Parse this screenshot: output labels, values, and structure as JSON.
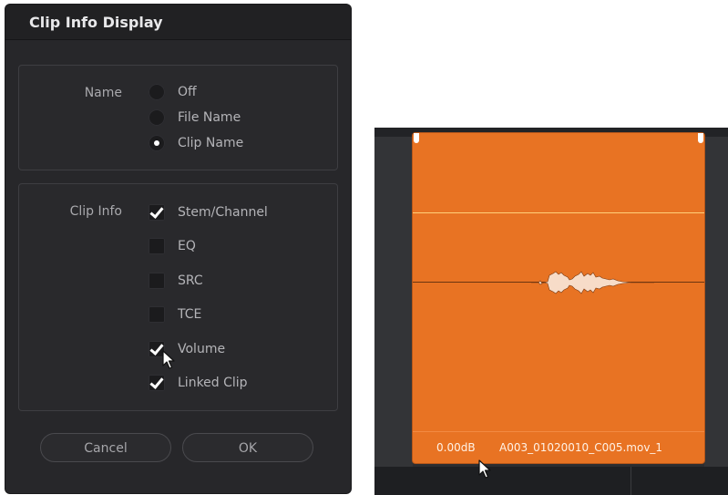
{
  "dialog": {
    "title": "Clip Info Display",
    "name_group": {
      "label": "Name",
      "options": [
        {
          "label": "Off",
          "selected": false
        },
        {
          "label": "File Name",
          "selected": false
        },
        {
          "label": "Clip Name",
          "selected": true
        }
      ]
    },
    "info_group": {
      "label": "Clip Info",
      "options": [
        {
          "label": "Stem/Channel",
          "checked": true
        },
        {
          "label": "EQ",
          "checked": false
        },
        {
          "label": "SRC",
          "checked": false
        },
        {
          "label": "TCE",
          "checked": false
        },
        {
          "label": "Volume",
          "checked": true
        },
        {
          "label": "Linked Clip",
          "checked": true
        }
      ]
    },
    "buttons": {
      "cancel": "Cancel",
      "ok": "OK"
    }
  },
  "timeline": {
    "clip": {
      "gain": "0.00dB",
      "name": "A003_01020010_C005.mov_1",
      "color": "#e87323"
    }
  }
}
